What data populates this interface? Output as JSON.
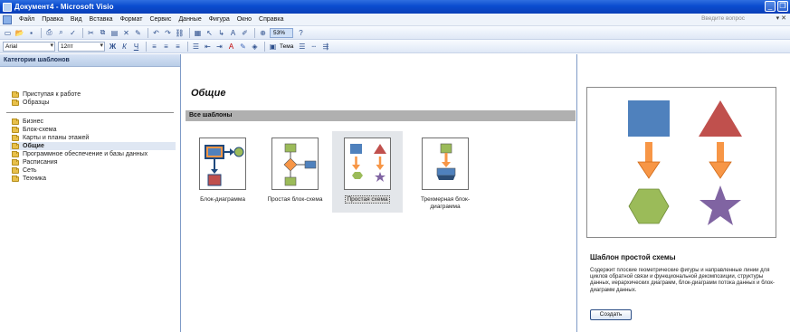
{
  "window": {
    "title": "Документ4 - Microsoft Visio"
  },
  "menu": {
    "items": [
      "Файл",
      "Правка",
      "Вид",
      "Вставка",
      "Формат",
      "Сервис",
      "Данные",
      "Фигура",
      "Окно",
      "Справка"
    ],
    "question_placeholder": "Введите вопрос"
  },
  "toolbar": {
    "font_name": "Arial",
    "font_size": "12пт",
    "zoom": "53%",
    "theme_label": "Тема",
    "bold_italic_underline": "Ж К Ч"
  },
  "left_panel": {
    "header": "Категории шаблонов",
    "top_items": [
      "Приступая к работе",
      "Образцы"
    ],
    "categories": [
      "Бизнес",
      "Блок-схема",
      "Карты и планы этажей",
      "Общие",
      "Программное обеспечение и базы данных",
      "Расписания",
      "Сеть",
      "Техника"
    ],
    "selected_index": 3
  },
  "center": {
    "title": "Общие",
    "section": "Все шаблоны",
    "templates": [
      {
        "label": "Блок-диаграмма",
        "icon": "block-diagram-icon"
      },
      {
        "label": "Простая блок-схема",
        "icon": "basic-flowchart-icon"
      },
      {
        "label": "Простая схема",
        "icon": "basic-diagram-icon"
      },
      {
        "label": "Трехмерная блок-диаграмма",
        "icon": "3d-block-diagram-icon"
      }
    ],
    "selected_template": 2
  },
  "right_panel": {
    "description_title": "Шаблон простой схемы",
    "description": "Содержит плоские геометрические фигуры и направленные линии для циклов обратной связи и функциональной декомпозиции, структуры данных, иерархических диаграмм, блок-диаграмм потока данных и блок-диаграмм данных.",
    "create_button": "Создать"
  },
  "colors": {
    "title_bar": "#0a4ccf",
    "square_blue": "#4f81bd",
    "triangle_red": "#c0504d",
    "arrow_orange": "#f79646",
    "hexagon_green": "#9bbb59",
    "star_purple": "#8064a2"
  }
}
